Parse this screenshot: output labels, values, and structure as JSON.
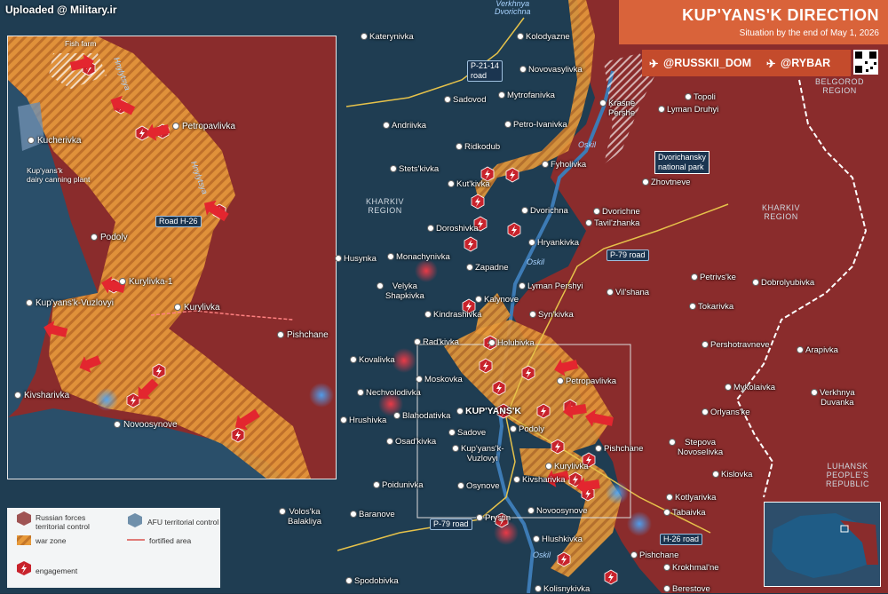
{
  "header": {
    "title": "KUP'YANS'K DIRECTION",
    "subtitle": "Situation by the end of May 1, 2026"
  },
  "social": {
    "handle1": "@RUSSKII_DOM",
    "handle2": "@RYBAR"
  },
  "watermark": "Uploaded @ Military.ir",
  "colors": {
    "russian_control": "#8a2c2c",
    "afu_control": "#1f3d52",
    "war_zone": "#e79a3b",
    "engagement": "#c8232c",
    "header": "#d9633a"
  },
  "regions": [
    {
      "text": "KHARKIV\nREGION"
    },
    {
      "text": "KHARKIV\nREGION"
    },
    {
      "text": "BELGOROD\nREGION"
    },
    {
      "text": "LUHANSK\nPEOPLE'S\nREPUBLIC"
    }
  ],
  "places": [
    "Katerynivka",
    "Kolodyazne",
    "Novovasylivka",
    "Sadovod",
    "Mytrofanivka",
    "Andriivka",
    "Petro-Ivanivka",
    "Ridkodub",
    "Stets'kivka",
    "Fyholivka",
    "Kut'kivka",
    "Dvorichna",
    "Dvorichne",
    "Zhovtneve",
    "Doroshivka",
    "Tavil'zhanka",
    "Hryankivka",
    "Husynka",
    "Monachynivka",
    "Zapadne",
    "Lyman Pershyi",
    "Vil'shana",
    "Velyka\nShapkivka",
    "Kalynove",
    "Kindrashivka",
    "Syn'kivka",
    "Rad'kivka",
    "Holubivka",
    "Kovalivka",
    "Moskovka",
    "Petropavlivka",
    "Nechvolodivka",
    "Blahodativka",
    "KUP'YANS'K",
    "Hrushivka",
    "Sadove",
    "Podoly",
    "Osad'kivka",
    "Kup'yans'k-\nVuzlovyi",
    "Pishchane",
    "Kurylivka",
    "Kivsharivka",
    "Poidunivka",
    "Osynove",
    "Novoosynove",
    "Baranove",
    "Prystin",
    "Hlushkivka",
    "Volos'ka\nBalakliya",
    "Spodobivka",
    "Kolisnykivka",
    "Topoli",
    "Lyman Druhyi",
    "Krasne\nPershe",
    "Petrivs'ke",
    "Dobrolyubivka",
    "Tokarivka",
    "Pershotravneve",
    "Arapivka",
    "Mykolaivka",
    "Verkhnya\nDuvanka",
    "Orlyans'ke",
    "Stepova\nNovoselivka",
    "Kislovka",
    "Kotlyarivka",
    "Tabaivka",
    "Pishchane",
    "Krokhmal'ne",
    "Berestove"
  ],
  "inset_places": [
    "Kucherivka",
    "Petropavlivka",
    "Podoly",
    "Kurylivka-1",
    "Kurylivka",
    "Kup'yans'k-Vuzlovyi",
    "Kivsharivka",
    "Novoosynove",
    "Pishchane"
  ],
  "roads": [
    {
      "text": "P-21-14\nroad"
    },
    {
      "text": "P-79 road"
    },
    {
      "text": "P-79 road"
    },
    {
      "text": "H-26 road"
    }
  ],
  "inset_road": "Road H-26",
  "rivers": [
    "Oskil",
    "Oskil",
    "Oskil",
    "Hnylytsya",
    "Hnylytsya",
    "Verkhnya\nDvorichna"
  ],
  "callouts": {
    "fish_farm": "Fish farm",
    "dairy": "Kup'yans'k\ndairy canning plant",
    "park": "Dvorichansky\nnational park"
  },
  "legend": {
    "russian": "Russian forces\nterritorial control",
    "afu": "AFU territorial control",
    "warzone": "war zone",
    "fortified": "fortified area",
    "engagement": "engagement"
  }
}
